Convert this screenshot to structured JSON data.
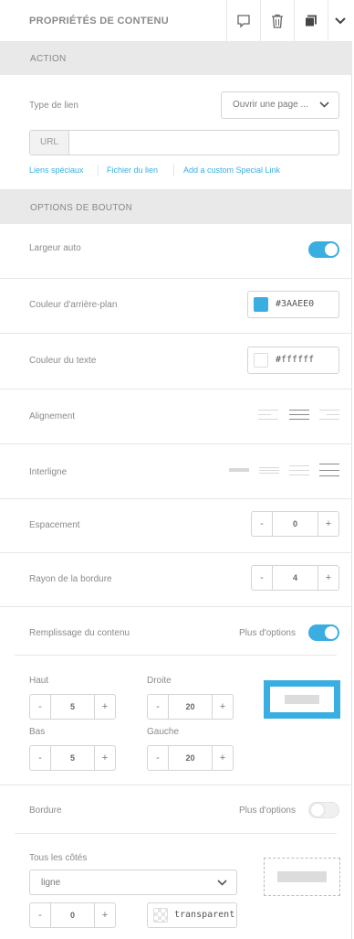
{
  "header": {
    "title": "PROPRIÉTÉS DE CONTENU"
  },
  "action": {
    "section_title": "ACTION",
    "link_type_label": "Type de lien",
    "link_type_value": "Ouvrir une page ...",
    "url_tag": "URL",
    "url_value": "",
    "links": [
      "Liens spéciaux",
      "Fichier du lien",
      "Add a custom Special Link"
    ]
  },
  "button_options": {
    "section_title": "OPTIONS DE BOUTON",
    "auto_width_label": "Largeur auto",
    "bg_color_label": "Couleur d'arrière-plan",
    "bg_color_value": "#3AAEE0",
    "text_color_label": "Couleur du texte",
    "text_color_value": "#ffffff",
    "alignment_label": "Alignement",
    "line_height_label": "Interligne",
    "spacing_label": "Espacement",
    "spacing_value": "0",
    "radius_label": "Rayon de la bordure",
    "radius_value": "4",
    "padding_label": "Remplissage du contenu",
    "more_options": "Plus d'options",
    "padding_top_label": "Haut",
    "padding_top_value": "5",
    "padding_right_label": "Droite",
    "padding_right_value": "20",
    "padding_bottom_label": "Bas",
    "padding_bottom_value": "5",
    "padding_left_label": "Gauche",
    "padding_left_value": "20",
    "border_label": "Bordure",
    "border_more_options": "Plus d'options",
    "all_sides_label": "Tous les côtés",
    "border_style_value": "ligne",
    "border_width_value": "0",
    "border_color_value": "transparent"
  },
  "colors": {
    "accent": "#3AAEE0",
    "section_bg": "#e9e9e9"
  }
}
